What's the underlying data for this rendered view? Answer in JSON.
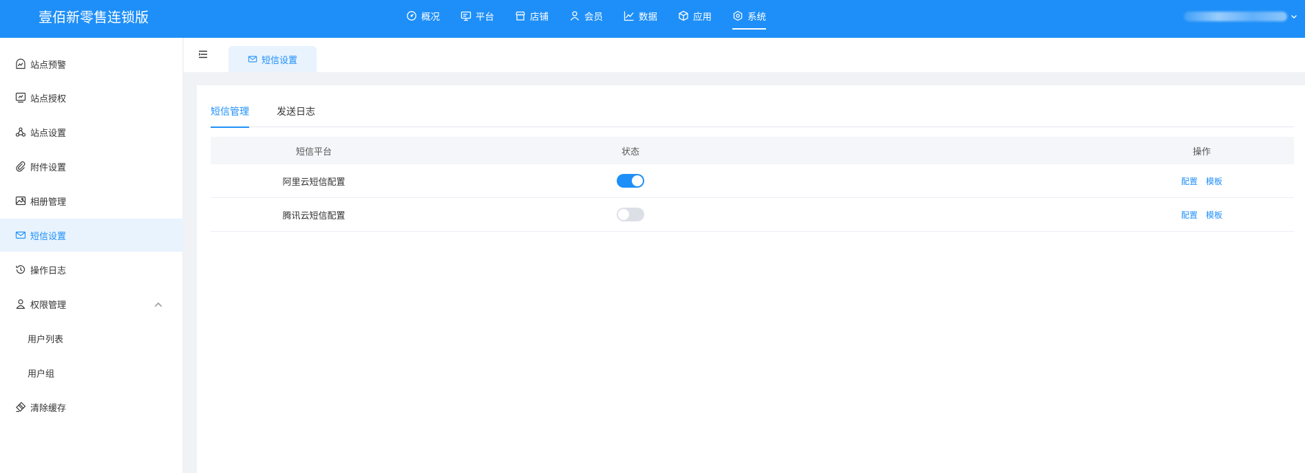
{
  "header": {
    "brand": "壹佰新零售连锁版",
    "nav": [
      {
        "label": "概况",
        "icon": "dashboard-icon",
        "active": false
      },
      {
        "label": "平台",
        "icon": "monitor-icon",
        "active": false
      },
      {
        "label": "店铺",
        "icon": "store-icon",
        "active": false
      },
      {
        "label": "会员",
        "icon": "user-icon",
        "active": false
      },
      {
        "label": "数据",
        "icon": "chart-line-icon",
        "active": false
      },
      {
        "label": "应用",
        "icon": "box-icon",
        "active": false
      },
      {
        "label": "系统",
        "icon": "gear-icon",
        "active": true
      }
    ]
  },
  "sidebar": {
    "items": [
      {
        "label": "站点预警",
        "icon": "alert-gauge-icon"
      },
      {
        "label": "站点授权",
        "icon": "license-icon"
      },
      {
        "label": "站点设置",
        "icon": "nodes-icon"
      },
      {
        "label": "附件设置",
        "icon": "paperclip-icon"
      },
      {
        "label": "相册管理",
        "icon": "image-icon"
      },
      {
        "label": "短信设置",
        "icon": "mail-icon",
        "active": true
      },
      {
        "label": "操作日志",
        "icon": "history-icon"
      },
      {
        "label": "权限管理",
        "icon": "user-icon",
        "expanded": true
      },
      {
        "label": "用户列表",
        "sub": true
      },
      {
        "label": "用户组",
        "sub": true
      },
      {
        "label": "清除缓存",
        "icon": "clear-icon"
      }
    ]
  },
  "tabs": {
    "open_tab": "短信设置"
  },
  "content": {
    "subtabs": [
      "短信管理",
      "发送日志"
    ],
    "active_subtab": 0,
    "table": {
      "columns": [
        "短信平台",
        "状态",
        "操作"
      ],
      "rows": [
        {
          "platform": "阿里云短信配置",
          "enabled": true,
          "actions": [
            "配置",
            "模板"
          ]
        },
        {
          "platform": "腾讯云短信配置",
          "enabled": false,
          "actions": [
            "配置",
            "模板"
          ]
        }
      ]
    }
  },
  "colors": {
    "primary": "#1e8ff8",
    "active_bg": "#e8f3fe",
    "switch_off": "#dcdfe6"
  }
}
